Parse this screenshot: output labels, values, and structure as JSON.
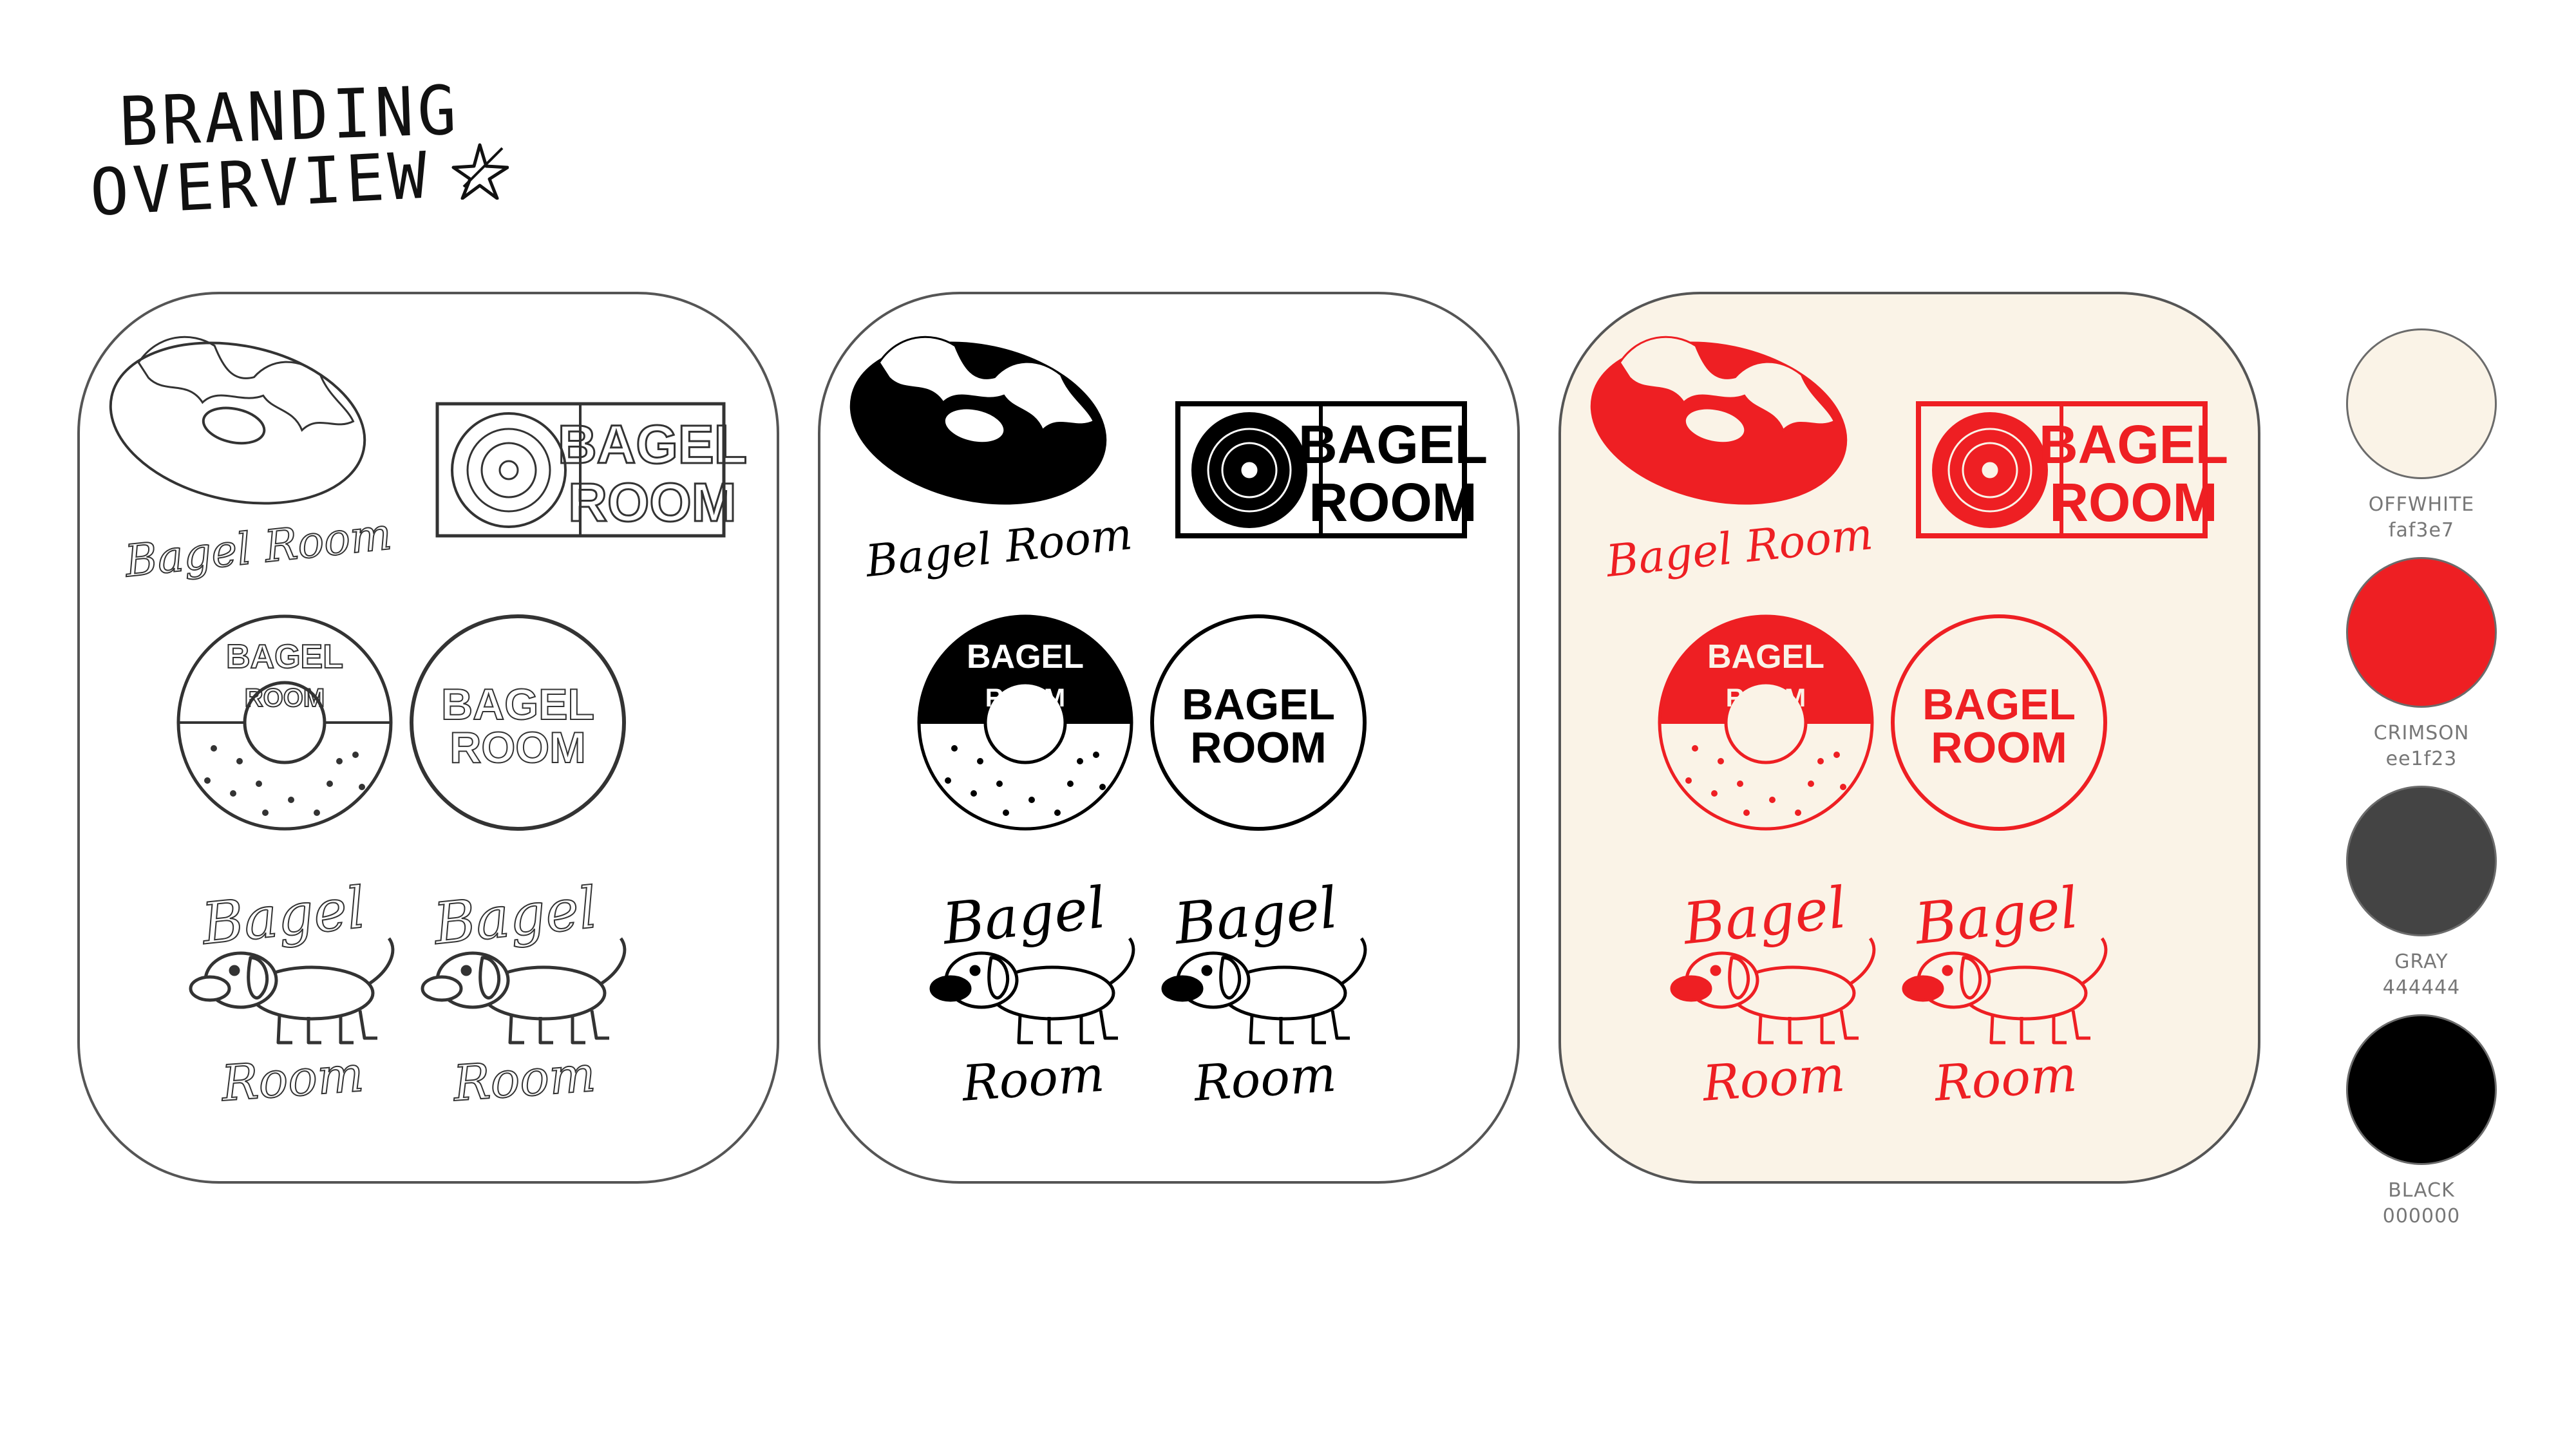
{
  "heading": {
    "line1": "BRANDING",
    "line2": "OVERVIEW",
    "star_icon": "star-doodle-icon"
  },
  "cards": [
    {
      "id": "outline",
      "variant": "outline",
      "background": "#ffffff",
      "ink": "#333333"
    },
    {
      "id": "black",
      "variant": "solid-black",
      "background": "#ffffff",
      "ink": "#000000"
    },
    {
      "id": "crimson",
      "variant": "solid-crimson",
      "background": "#faf3e7",
      "ink": "#ee1f23"
    }
  ],
  "logos": {
    "script_wordmark": "Bagel Room",
    "block_word1": "BAGEL",
    "block_word2": "ROOM",
    "script_word1": "Bagel",
    "script_word2": "Room",
    "icons": [
      "vinyl-bagel-icon",
      "record-icon",
      "bagel-badge-icon",
      "dog-mascot-icon"
    ]
  },
  "palette": [
    {
      "name": "OFFWHITE",
      "hex": "faf3e7",
      "color": "#faf3e7"
    },
    {
      "name": "CRIMSON",
      "hex": "ee1f23",
      "color": "#ee1f23"
    },
    {
      "name": "GRAY",
      "hex": "444444",
      "color": "#444444"
    },
    {
      "name": "BLACK",
      "hex": "000000",
      "color": "#000000"
    }
  ]
}
